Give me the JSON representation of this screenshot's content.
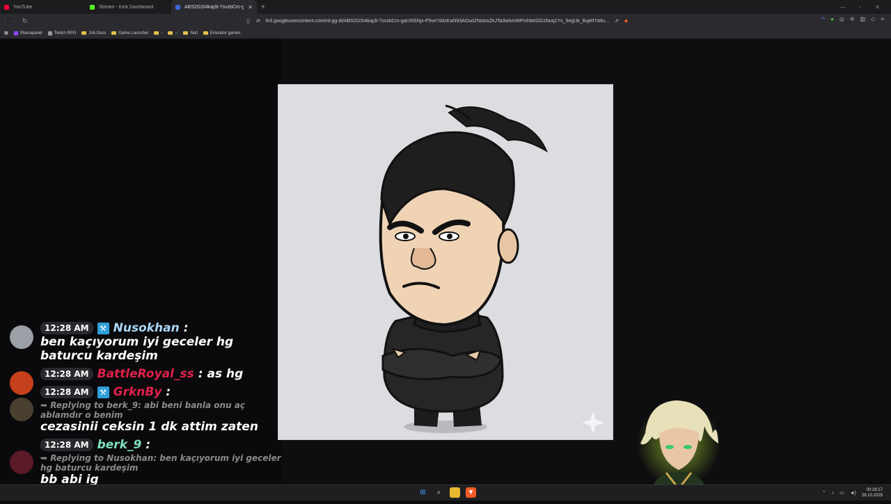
{
  "tabs": [
    {
      "title": "YouTube",
      "color": "#ff0033"
    },
    {
      "title": "Stream - Kick Dashboard",
      "color": "#53fc18"
    },
    {
      "title": "ABS2GSI4kaj3l-7svzbCm-gaUN...",
      "color": "#3a6ad6"
    }
  ],
  "address": {
    "url": "lh3.googleusercontent.com/rd-gg-dl/ABS2GSI4kaj3l-7svzbCm-gaUNSNjx-P5ve7dArKaN93AOud2NstoxZkJTa3wlsmNPrvhbtrGG1Nuq1Ys_5egUk_8ujelf7d4u..."
  },
  "bookmarks": [
    "Shanapanel",
    "Twitch RPG",
    "Job Docs",
    "Game Launcher",
    "-",
    "--",
    "Null",
    "Emulator games"
  ],
  "chat": [
    {
      "time": "12:28 AM",
      "user": "Nusokhan",
      "user_color": "#a9d6f5",
      "badge": true,
      "text": "ben kaçıyorum iyi geceler hg baturcu kardeşim",
      "reply": ""
    },
    {
      "time": "12:28 AM",
      "user": "BattleRoyal_ss",
      "user_color": "#e0204a",
      "badge": false,
      "text": "as hg",
      "reply": ""
    },
    {
      "time": "12:28 AM",
      "user": "GrknBy",
      "user_color": "#e0204a",
      "badge": true,
      "text": "cezasinii ceksin 1 dk attim zaten",
      "reply": "➥ Replying to berk_9: abi beni banla onu aç ablamdır o benim"
    },
    {
      "time": "12:28 AM",
      "user": "berk_9",
      "user_color": "#7ee0c0",
      "badge": false,
      "text": "bb abi ig",
      "reply": "➥ Replying to Nusokhan: ben kaçıyorum iyi geceler hg baturcu kardeşim"
    }
  ],
  "clock": {
    "time": "00:28:17",
    "date": "28.10.2025"
  }
}
